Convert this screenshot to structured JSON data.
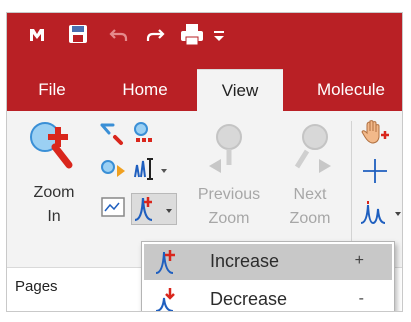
{
  "quick_access": {
    "icons": [
      "app-icon",
      "save-icon",
      "undo-icon",
      "redo-icon",
      "print-icon",
      "customize-qat-icon"
    ]
  },
  "tabs": [
    {
      "label": "File",
      "active": false
    },
    {
      "label": "Home",
      "active": false
    },
    {
      "label": "View",
      "active": true
    },
    {
      "label": "Molecule",
      "active": false
    }
  ],
  "ribbon": {
    "zoom_in": {
      "line1": "Zoom",
      "line2": "In"
    },
    "previous_zoom": {
      "line1": "Previous",
      "line2": "Zoom"
    },
    "next_zoom": {
      "line1": "Next",
      "line2": "Zoom"
    }
  },
  "pages_pane": {
    "label": "Pages"
  },
  "dropdown": {
    "items": [
      {
        "label": "Increase",
        "shortcut": "+",
        "highlighted": true
      },
      {
        "label": "Decrease",
        "shortcut": "-",
        "highlighted": false
      }
    ]
  },
  "colors": {
    "brand_red": "#b92025",
    "icon_red": "#d9261c",
    "icon_blue": "#1f5fbf",
    "disabled_grey": "#a7a7a7",
    "menu_highlight": "#c8c8c8"
  }
}
